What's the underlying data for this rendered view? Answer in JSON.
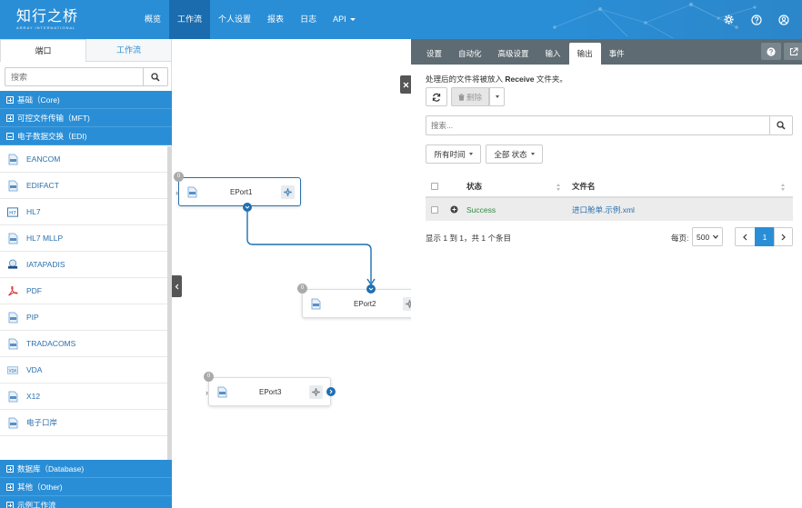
{
  "brand": {
    "name": "知行之桥",
    "tagline": "ARRAY INTERNATIONAL"
  },
  "nav": {
    "items": [
      "概览",
      "工作流",
      "个人设置",
      "报表",
      "日志",
      "API"
    ],
    "active_index": 1
  },
  "left": {
    "tabs": [
      "端口",
      "工作流"
    ],
    "search_placeholder": "搜索",
    "groups_top": [
      "基础（Core)",
      "可控文件传输（MFT)",
      "电子数据交换（EDI)"
    ],
    "ports": [
      "EANCOM",
      "EDIFACT",
      "HL7",
      "HL7 MLLP",
      "IATAPADIS",
      "PDF",
      "PIP",
      "TRADACOMS",
      "VDA",
      "X12",
      "电子口岸"
    ],
    "groups_bottom": [
      "数据库（Database)",
      "其他（Other)",
      "示例工作流"
    ]
  },
  "canvas": {
    "nodes": [
      {
        "name": "EPort1",
        "badge": "0"
      },
      {
        "name": "EPort2",
        "badge": "0"
      },
      {
        "name": "EPort3",
        "badge": "0"
      }
    ]
  },
  "right": {
    "tabs": [
      "设置",
      "自动化",
      "高级设置",
      "输入",
      "输出",
      "事件"
    ],
    "active_tab": 4,
    "desc_prefix": "处理后的文件将被放入",
    "desc_folder": "Receive",
    "desc_suffix": "文件夹。",
    "delete_label": "删除",
    "search_placeholder": "搜索...",
    "filter_time": "所有时间",
    "filter_status": "全部 状态",
    "columns": {
      "status": "状态",
      "filename": "文件名"
    },
    "rows": [
      {
        "status": "Success",
        "filename": "进口舱单.示例.xml"
      }
    ],
    "info": "显示 1 到 1，共 1 个条目",
    "per_page_label": "每页:",
    "per_page_value": "500",
    "current_page": "1"
  },
  "colors": {
    "primary": "#2a8ed6",
    "nav_active": "#1b6cae",
    "tab_bar": "#5e6b73",
    "success": "#2e8b3e",
    "link": "#2a6fad"
  }
}
